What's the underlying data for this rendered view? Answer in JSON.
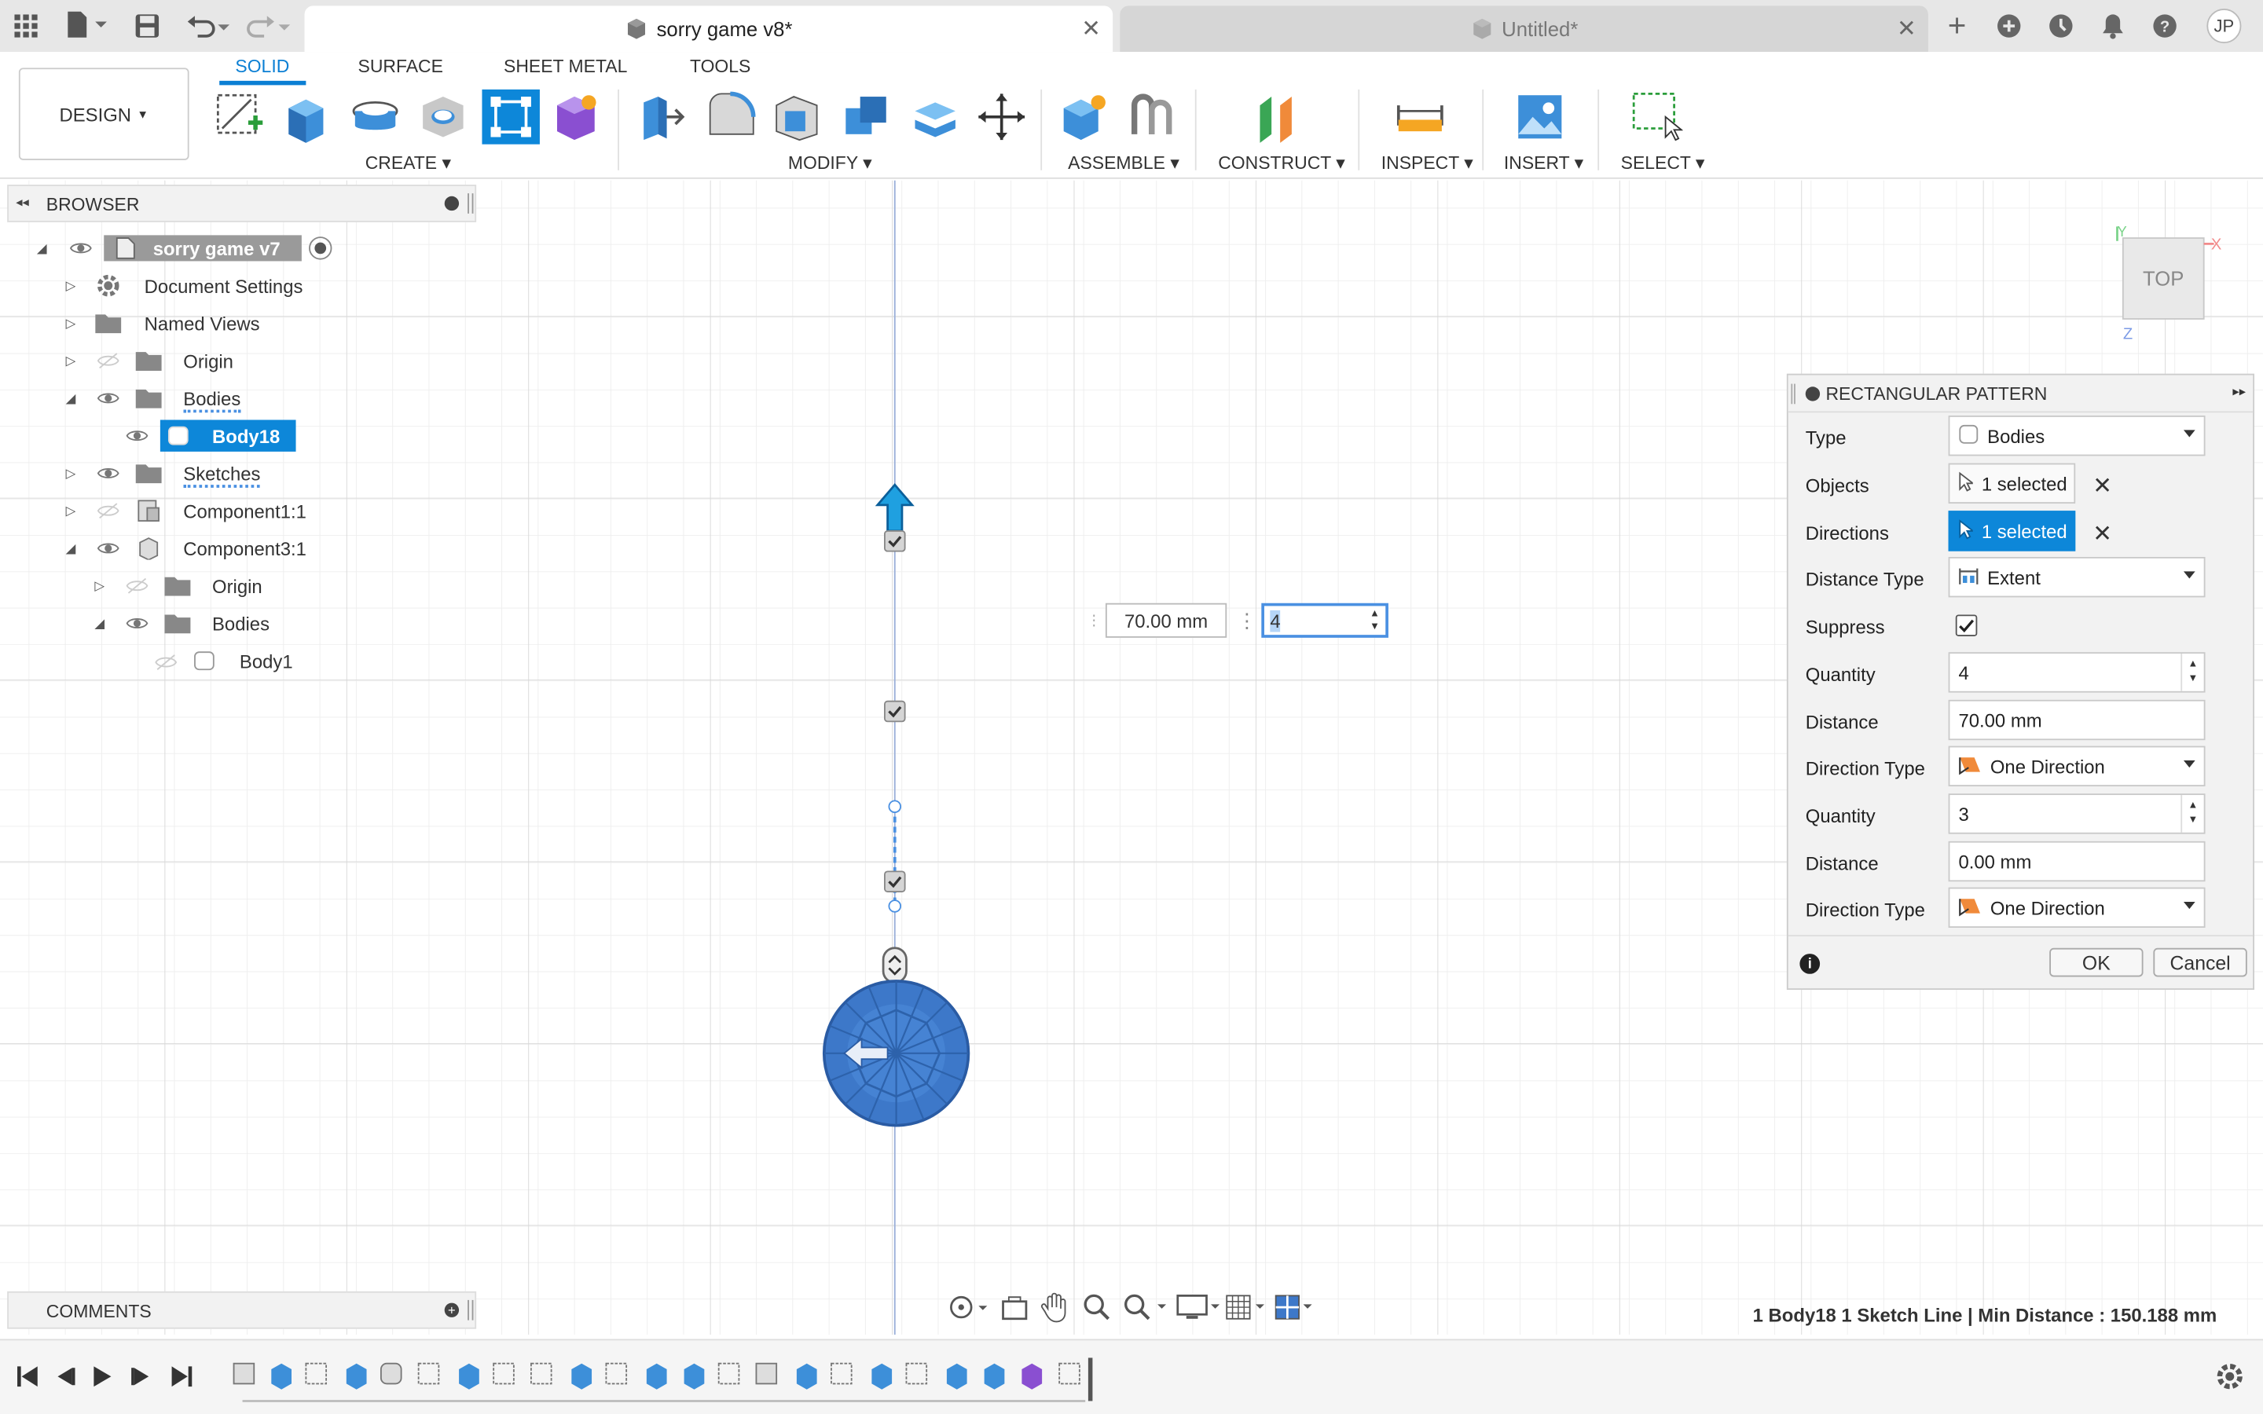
{
  "window": {
    "tabs": [
      {
        "label": "sorry game v8*",
        "active": true
      },
      {
        "label": "Untitled*",
        "active": false
      }
    ],
    "user_initials": "JP"
  },
  "ribbon": {
    "tabs": [
      "SOLID",
      "SURFACE",
      "SHEET METAL",
      "TOOLS"
    ],
    "active_tab": "SOLID",
    "workspace": "DESIGN",
    "groups": [
      "CREATE",
      "MODIFY",
      "ASSEMBLE",
      "CONSTRUCT",
      "INSPECT",
      "INSERT",
      "SELECT"
    ]
  },
  "browser": {
    "title": "BROWSER",
    "root": "sorry game v7",
    "items": [
      {
        "label": "Document Settings"
      },
      {
        "label": "Named Views"
      },
      {
        "label": "Origin"
      },
      {
        "label": "Bodies"
      },
      {
        "label": "Body18",
        "selected": true
      },
      {
        "label": "Sketches"
      },
      {
        "label": "Component1:1"
      },
      {
        "label": "Component3:1"
      },
      {
        "label": "Origin"
      },
      {
        "label": "Bodies"
      },
      {
        "label": "Body1"
      }
    ]
  },
  "canvas": {
    "distance_input": "70.00 mm",
    "quantity_input": "4",
    "viewcube_label": "TOP",
    "axis_labels": [
      "Y",
      "X",
      "Z"
    ]
  },
  "dialog": {
    "title": "RECTANGULAR PATTERN",
    "rows": {
      "type_label": "Type",
      "type_value": "Bodies",
      "objects_label": "Objects",
      "objects_value": "1 selected",
      "directions_label": "Directions",
      "directions_value": "1 selected",
      "distance_type_label": "Distance Type",
      "distance_type_value": "Extent",
      "suppress_label": "Suppress",
      "quantity1_label": "Quantity",
      "quantity1_value": "4",
      "distance1_label": "Distance",
      "distance1_value": "70.00 mm",
      "direction_type1_label": "Direction Type",
      "direction_type1_value": "One Direction",
      "quantity2_label": "Quantity",
      "quantity2_value": "3",
      "distance2_label": "Distance",
      "distance2_value": "0.00 mm",
      "direction_type2_label": "Direction Type",
      "direction_type2_value": "One Direction"
    },
    "suppress_checked": true,
    "ok_label": "OK",
    "cancel_label": "Cancel"
  },
  "comments": {
    "title": "COMMENTS"
  },
  "status_text": "1 Body18 1 Sketch Line | Min Distance : 150.188 mm",
  "colors": {
    "accent": "#0b7fd4",
    "selection": "#0d87d9",
    "body_blue": "#3d78c9"
  }
}
